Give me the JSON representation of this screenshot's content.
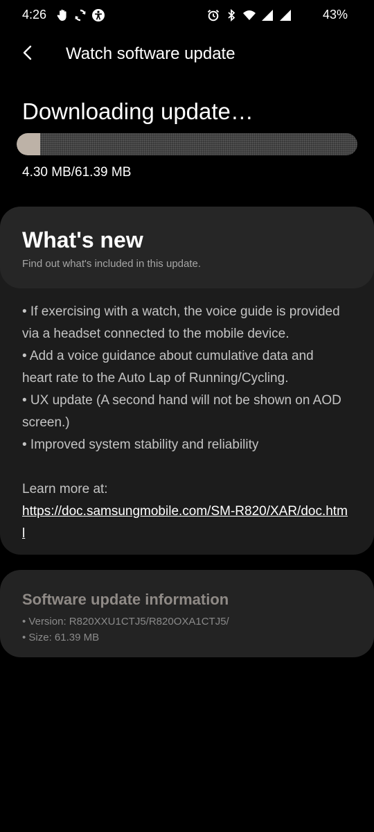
{
  "status_bar": {
    "time": "4:26",
    "battery": "43%",
    "left_icons": [
      "hand-icon",
      "sync-icon",
      "accessibility-icon"
    ],
    "right_icons": [
      "alarm-icon",
      "bluetooth-icon",
      "wifi-icon",
      "signal-icon",
      "signal-icon"
    ]
  },
  "header": {
    "title": "Watch software update"
  },
  "download": {
    "title": "Downloading update…",
    "progress_fraction": 0.07,
    "progress_text": "4.30 MB/61.39 MB",
    "progress_color": "#bdb2a7"
  },
  "whats_new": {
    "title": "What's new",
    "subtitle": "Find out what's included in this update.",
    "notes": [
      "• If exercising with a watch, the voice guide is provided",
      "via a headset connected to the mobile device.",
      "• Add a voice guidance about cumulative data and",
      "heart rate to the Auto Lap of Running/Cycling.",
      "• UX update (A second hand will not be shown on AOD",
      "screen.)",
      "• Improved system stability and reliability"
    ],
    "learn_more_label": "Learn more at:",
    "learn_more_link": "https://doc.samsungmobile.com/SM-R820/XAR/doc.html"
  },
  "update_info": {
    "title": "Software update information",
    "version": "• Version: R820XXU1CTJ5/R820OXA1CTJ5/",
    "size": "• Size: 61.39 MB"
  }
}
